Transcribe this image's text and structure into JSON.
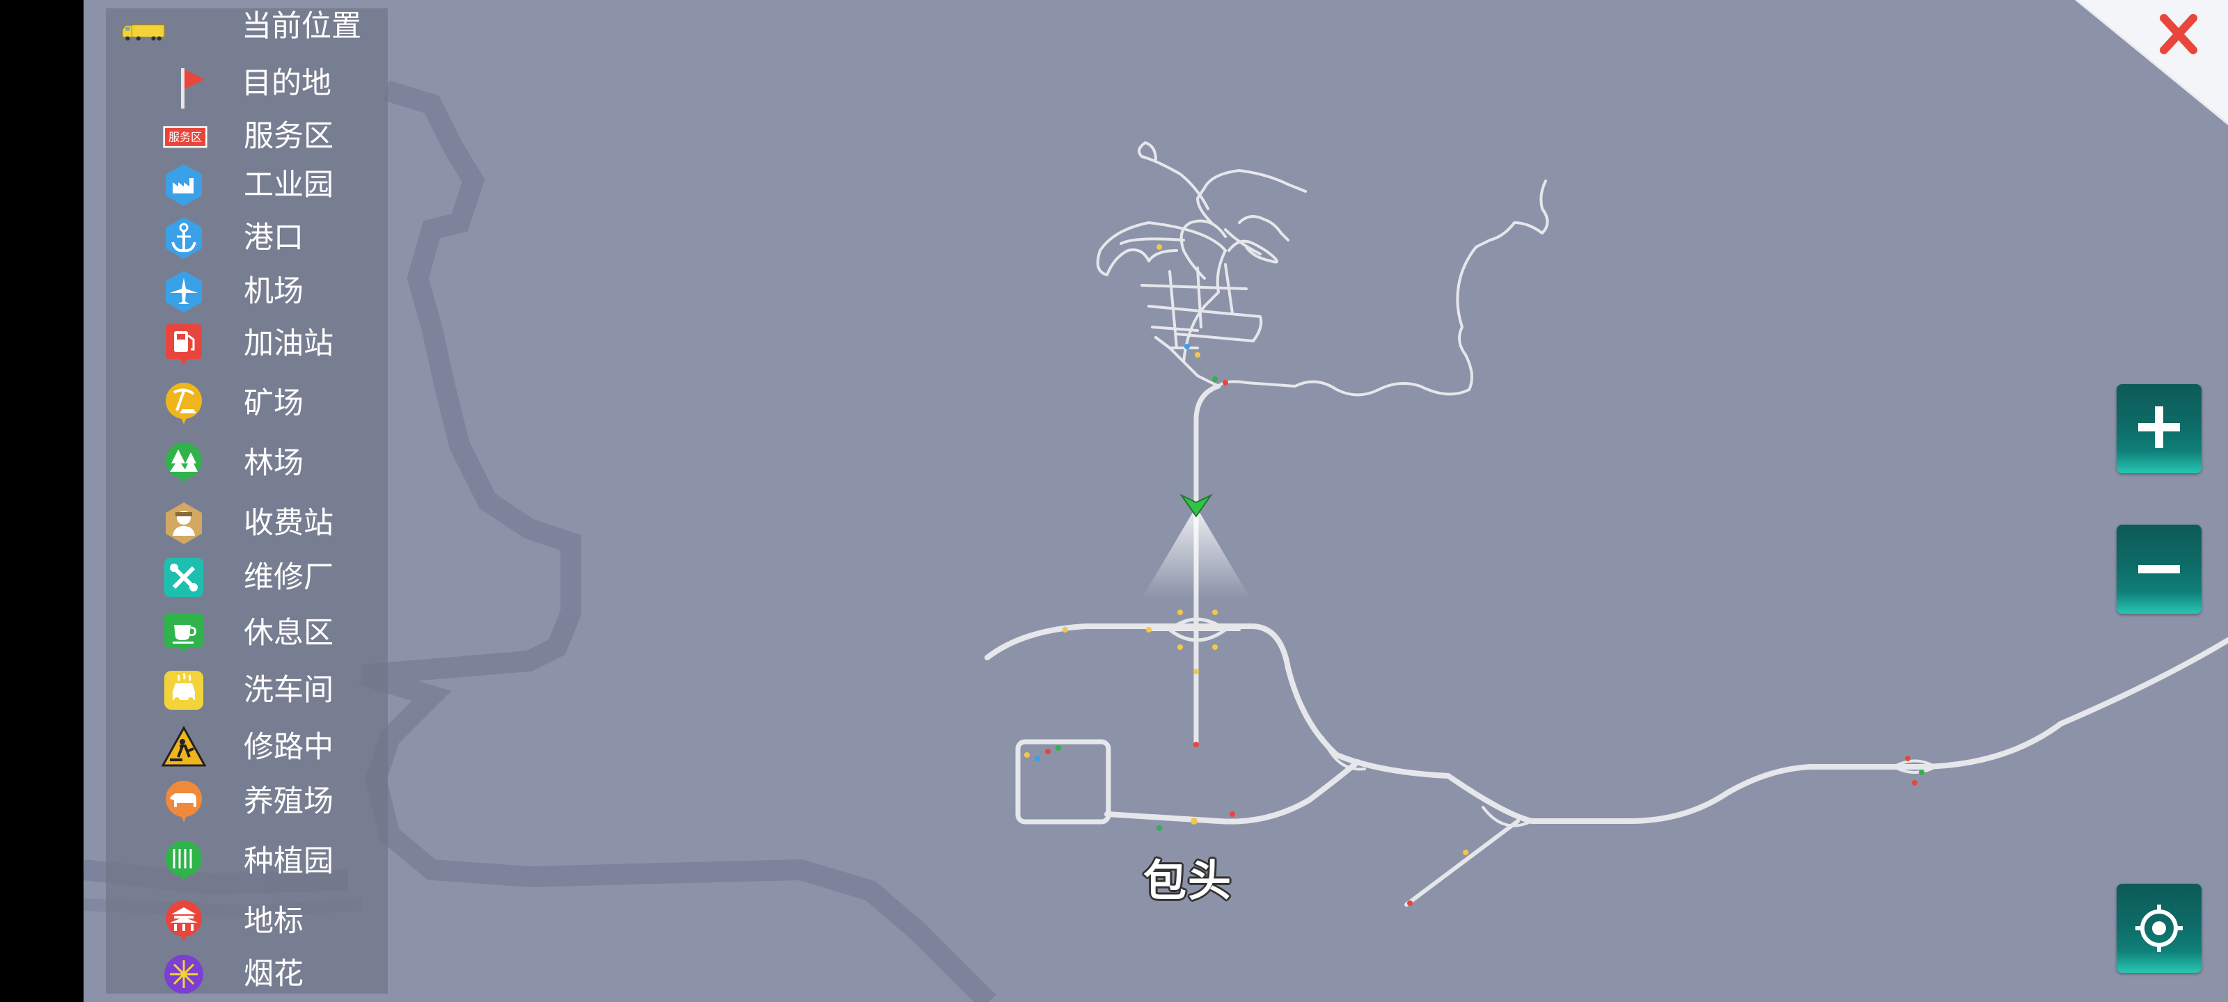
{
  "legend": {
    "items": [
      {
        "label": "当前位置",
        "icon": "truck-icon"
      },
      {
        "label": "目的地",
        "icon": "flag-icon"
      },
      {
        "label": "服务区",
        "icon": "service-area-icon",
        "badge_text": "服务区"
      },
      {
        "label": "工业园",
        "icon": "factory-icon"
      },
      {
        "label": "港口",
        "icon": "anchor-icon"
      },
      {
        "label": "机场",
        "icon": "airplane-icon"
      },
      {
        "label": "加油站",
        "icon": "fuel-pump-icon"
      },
      {
        "label": "矿场",
        "icon": "pickaxe-icon"
      },
      {
        "label": "林场",
        "icon": "tree-icon"
      },
      {
        "label": "收费站",
        "icon": "toll-collector-icon"
      },
      {
        "label": "维修厂",
        "icon": "wrench-icon"
      },
      {
        "label": "休息区",
        "icon": "coffee-cup-icon"
      },
      {
        "label": "洗车间",
        "icon": "car-wash-icon"
      },
      {
        "label": "修路中",
        "icon": "road-work-icon"
      },
      {
        "label": "养殖场",
        "icon": "cow-icon"
      },
      {
        "label": "种植园",
        "icon": "crops-icon"
      },
      {
        "label": "地标",
        "icon": "landmark-icon"
      },
      {
        "label": "烟花",
        "icon": "fireworks-icon"
      }
    ]
  },
  "map": {
    "city_label": "包头"
  },
  "controls": {
    "close": "close-icon",
    "zoom_in": "plus-icon",
    "zoom_out": "minus-icon",
    "locate": "crosshair-icon"
  },
  "colors": {
    "map_background": "#8c93a9",
    "road": "#e6e7eb",
    "legend_panel": "#707688",
    "button_teal": "#0e6a66",
    "close_red": "#e8463c"
  }
}
